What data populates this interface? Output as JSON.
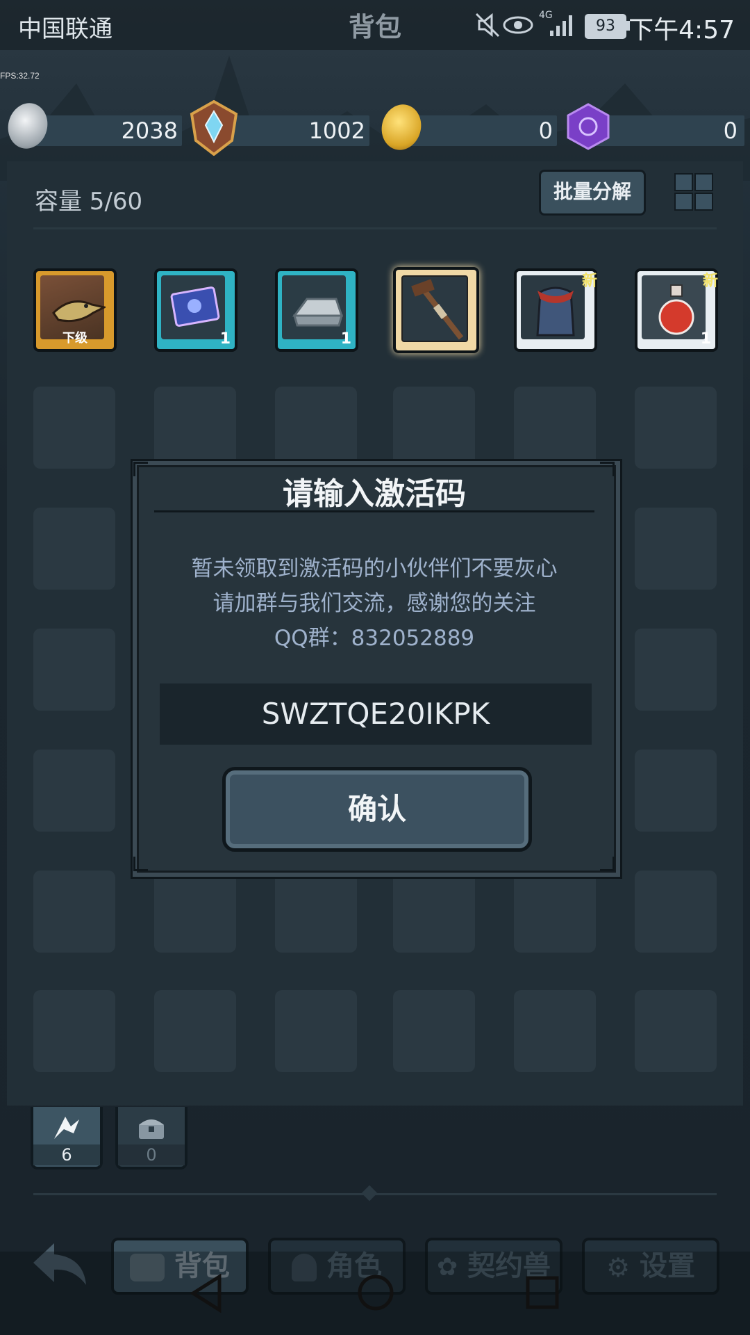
{
  "status_bar": {
    "carrier": "中国联通",
    "title": "背包",
    "network": "4G",
    "battery": "93",
    "time": "下午4:57"
  },
  "fps": "FPS:32.72",
  "currencies": [
    {
      "icon": "silver-coin-icon",
      "value": "2038"
    },
    {
      "icon": "crystal-emblem-icon",
      "value": "1002"
    },
    {
      "icon": "gold-coin-icon",
      "value": "0"
    },
    {
      "icon": "purple-gem-icon",
      "value": "0"
    }
  ],
  "inventory": {
    "capacity": "容量 5/60",
    "batch_button": "批量分解",
    "items": [
      {
        "name": "map-lizard-item",
        "tag": "下级",
        "count": ""
      },
      {
        "name": "scroll-item",
        "tag": "",
        "count": "1"
      },
      {
        "name": "metal-ingot-item",
        "tag": "",
        "count": "1"
      },
      {
        "name": "wooden-staff-item",
        "tag": "",
        "count": ""
      },
      {
        "name": "cloak-armor-item",
        "tag": "新",
        "count": ""
      },
      {
        "name": "red-potion-item",
        "tag": "新",
        "count": "1"
      }
    ]
  },
  "dialog": {
    "title": "请输入激活码",
    "line1": "暂未领取到激活码的小伙伴们不要灰心",
    "line2": "请加群与我们交流，感谢您的关注",
    "line3": "QQ群：832052889",
    "code_value": "SWZTQE20IKPK",
    "confirm": "确认"
  },
  "mini_tabs": [
    {
      "icon": "skill-icon",
      "count": "6"
    },
    {
      "icon": "chest-icon",
      "count": "0"
    }
  ],
  "nav": {
    "back": "back-arrow-icon",
    "items": [
      "背包",
      "角色",
      "契约兽",
      "设置"
    ]
  },
  "colors": {
    "accent_gold": "#f2e26b",
    "selected_border": "#f1d9a6",
    "panel": "#222f37"
  }
}
